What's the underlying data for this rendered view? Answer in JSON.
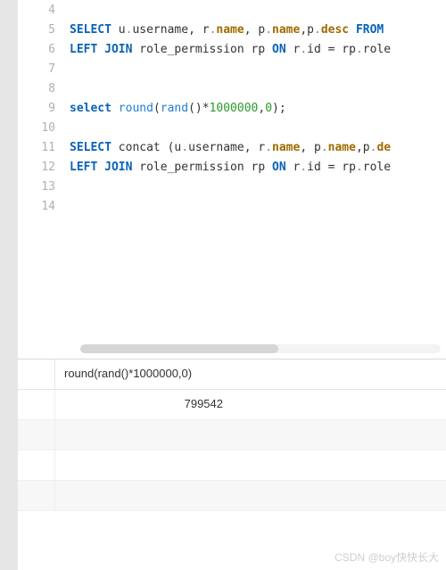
{
  "editor": {
    "lines": [
      {
        "num": 4,
        "tokens": []
      },
      {
        "num": 5,
        "tokens": [
          {
            "t": "kw",
            "v": "SELECT "
          },
          {
            "t": "id",
            "v": "u"
          },
          {
            "t": "dot",
            "v": "."
          },
          {
            "t": "id",
            "v": "username"
          },
          {
            "t": "op",
            "v": ", "
          },
          {
            "t": "id",
            "v": "r"
          },
          {
            "t": "dot",
            "v": "."
          },
          {
            "t": "field",
            "v": "name"
          },
          {
            "t": "op",
            "v": ", "
          },
          {
            "t": "id",
            "v": "p"
          },
          {
            "t": "dot",
            "v": "."
          },
          {
            "t": "field",
            "v": "name"
          },
          {
            "t": "op",
            "v": ","
          },
          {
            "t": "id",
            "v": "p"
          },
          {
            "t": "dot",
            "v": "."
          },
          {
            "t": "field",
            "v": "desc"
          },
          {
            "t": "kw",
            "v": " FROM"
          }
        ]
      },
      {
        "num": 6,
        "tokens": [
          {
            "t": "kw",
            "v": "LEFT JOIN"
          },
          {
            "t": "id",
            "v": " role_permission rp "
          },
          {
            "t": "kw",
            "v": "ON"
          },
          {
            "t": "id",
            "v": " r"
          },
          {
            "t": "dot",
            "v": "."
          },
          {
            "t": "id",
            "v": "id "
          },
          {
            "t": "op",
            "v": "= "
          },
          {
            "t": "id",
            "v": "rp"
          },
          {
            "t": "dot",
            "v": "."
          },
          {
            "t": "id",
            "v": "role"
          }
        ]
      },
      {
        "num": 7,
        "tokens": []
      },
      {
        "num": 8,
        "tokens": []
      },
      {
        "num": 9,
        "tokens": [
          {
            "t": "kw",
            "v": "select "
          },
          {
            "t": "fn",
            "v": "round"
          },
          {
            "t": "op",
            "v": "("
          },
          {
            "t": "fn",
            "v": "rand"
          },
          {
            "t": "op",
            "v": "()*"
          },
          {
            "t": "num",
            "v": "1000000"
          },
          {
            "t": "op",
            "v": ","
          },
          {
            "t": "num",
            "v": "0"
          },
          {
            "t": "op",
            "v": ");"
          }
        ]
      },
      {
        "num": 10,
        "tokens": []
      },
      {
        "num": 11,
        "tokens": [
          {
            "t": "kw",
            "v": "SELECT "
          },
          {
            "t": "id",
            "v": "concat "
          },
          {
            "t": "op",
            "v": "("
          },
          {
            "t": "id",
            "v": "u"
          },
          {
            "t": "dot",
            "v": "."
          },
          {
            "t": "id",
            "v": "username"
          },
          {
            "t": "op",
            "v": ", "
          },
          {
            "t": "id",
            "v": "r"
          },
          {
            "t": "dot",
            "v": "."
          },
          {
            "t": "field",
            "v": "name"
          },
          {
            "t": "op",
            "v": ", "
          },
          {
            "t": "id",
            "v": "p"
          },
          {
            "t": "dot",
            "v": "."
          },
          {
            "t": "field",
            "v": "name"
          },
          {
            "t": "op",
            "v": ","
          },
          {
            "t": "id",
            "v": "p"
          },
          {
            "t": "dot",
            "v": "."
          },
          {
            "t": "field",
            "v": "de"
          }
        ]
      },
      {
        "num": 12,
        "tokens": [
          {
            "t": "kw",
            "v": "LEFT JOIN"
          },
          {
            "t": "id",
            "v": " role_permission rp "
          },
          {
            "t": "kw",
            "v": "ON"
          },
          {
            "t": "id",
            "v": " r"
          },
          {
            "t": "dot",
            "v": "."
          },
          {
            "t": "id",
            "v": "id "
          },
          {
            "t": "op",
            "v": "= "
          },
          {
            "t": "id",
            "v": "rp"
          },
          {
            "t": "dot",
            "v": "."
          },
          {
            "t": "id",
            "v": "role"
          }
        ]
      },
      {
        "num": 13,
        "tokens": []
      },
      {
        "num": 14,
        "tokens": []
      }
    ]
  },
  "results": {
    "column_header": "round(rand()*1000000,0)",
    "rows": [
      {
        "value": "799542"
      }
    ],
    "empty_rows": 3
  },
  "watermark": "CSDN @boy快快长大"
}
